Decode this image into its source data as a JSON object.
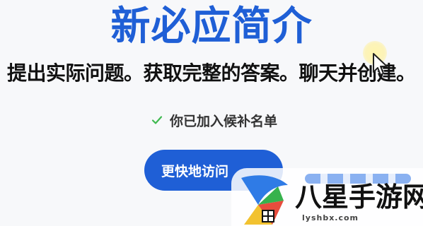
{
  "hero": {
    "title": "新必应简介",
    "subtitle": "提出实际问题。获取完整的答案。聊天并创建。"
  },
  "waitlist": {
    "status": "你已加入候补名单",
    "check_color": "#3fb950"
  },
  "cta": {
    "label": "更快地访问"
  },
  "colors": {
    "accent": "#1f5fd6",
    "text": "#111111",
    "background": "#f7f8fa"
  },
  "watermark": {
    "brand": "八星手游网",
    "domain": "lyshbx.com"
  }
}
